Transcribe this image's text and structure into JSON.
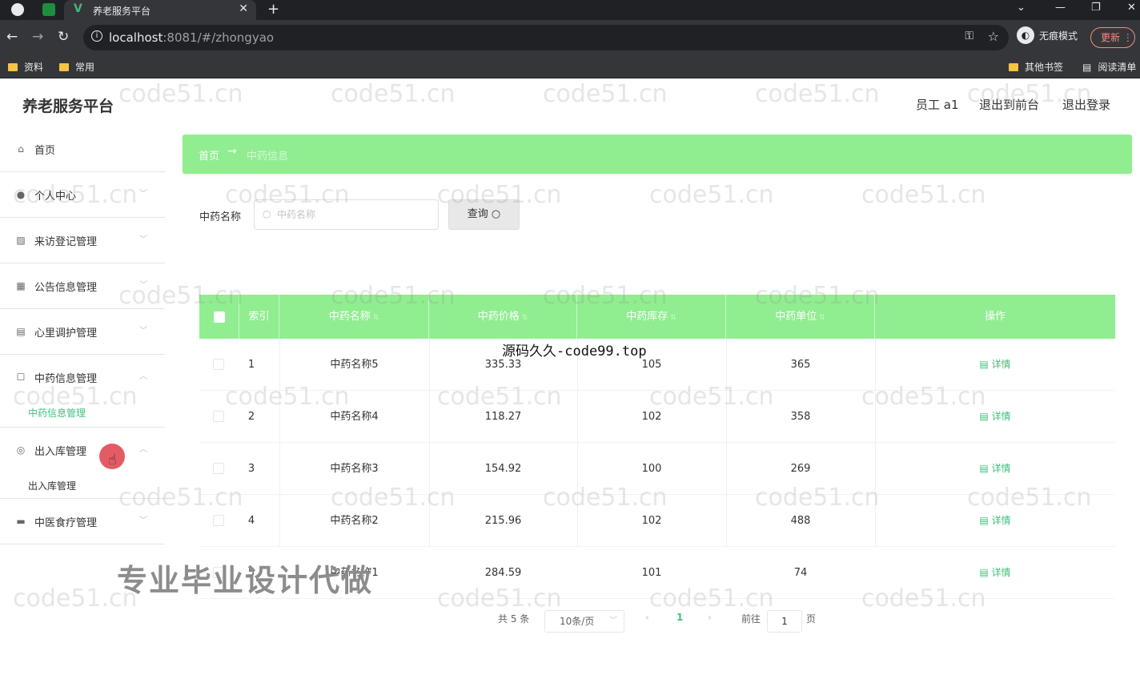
{
  "browser": {
    "tab_title": "养老服务平台",
    "url_host": "localhost",
    "url_rest": ":8081/#/zhongyao",
    "incognito_label": "无痕模式",
    "update_label": "更新",
    "bookmarks": [
      "资料",
      "常用"
    ],
    "other_bookmarks": "其他书签",
    "reading_list": "阅读清单"
  },
  "header": {
    "brand": "养老服务平台",
    "user": "员工 a1",
    "back_to_front": "退出到前台",
    "logout": "退出登录"
  },
  "sidebar": {
    "items": [
      {
        "label": "首页",
        "icon": "home-icon"
      },
      {
        "label": "个人中心",
        "icon": "user-icon"
      },
      {
        "label": "来访登记管理",
        "icon": "chart-icon"
      },
      {
        "label": "公告信息管理",
        "icon": "grid-icon"
      },
      {
        "label": "心里调护管理",
        "icon": "clipboard-icon"
      },
      {
        "label": "中药信息管理",
        "icon": "box-icon",
        "sub": "中药信息管理"
      },
      {
        "label": "出入库管理",
        "icon": "circle-icon",
        "sub": "出入库管理"
      },
      {
        "label": "中医食疗管理",
        "icon": "briefcase-icon"
      }
    ]
  },
  "breadcrumb": {
    "home": "首页",
    "sep": "→",
    "current": "中药信息"
  },
  "search": {
    "label": "中药名称",
    "placeholder": "中药名称",
    "button": "查询"
  },
  "table": {
    "headers": [
      "索引",
      "中药名称",
      "中药价格",
      "中药库存",
      "中药单位",
      "操作"
    ],
    "rows": [
      {
        "idx": "1",
        "name": "中药名称5",
        "price": "335.33",
        "stock": "105",
        "unit": "365",
        "action": "详情"
      },
      {
        "idx": "2",
        "name": "中药名称4",
        "price": "118.27",
        "stock": "102",
        "unit": "358",
        "action": "详情"
      },
      {
        "idx": "3",
        "name": "中药名称3",
        "price": "154.92",
        "stock": "100",
        "unit": "269",
        "action": "详情"
      },
      {
        "idx": "4",
        "name": "中药名称2",
        "price": "215.96",
        "stock": "102",
        "unit": "488",
        "action": "详情"
      },
      {
        "idx": "5",
        "name": "中药名称1",
        "price": "284.59",
        "stock": "101",
        "unit": "74",
        "action": "详情"
      }
    ]
  },
  "pagination": {
    "total": "共 5 条",
    "page_size": "10条/页",
    "current": "1",
    "goto_prefix": "前往",
    "goto_value": "1",
    "goto_suffix": "页"
  },
  "overlays": {
    "watermark": "code51.cn",
    "caption": "源码久久-code99.top",
    "promo": "专业毕业设计代做"
  },
  "colors": {
    "accent_green": "#90ee90",
    "link_green": "#3fc07e"
  }
}
